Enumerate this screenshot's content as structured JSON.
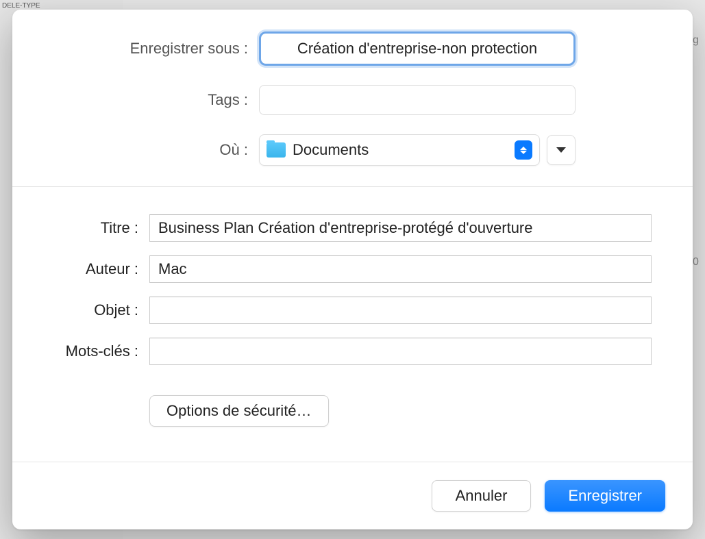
{
  "background": {
    "header": "DELE-TYPE"
  },
  "dialog": {
    "save_as_label": "Enregistrer sous :",
    "save_as_value": "Création d'entreprise-non protection",
    "tags_label": "Tags :",
    "tags_value": "",
    "where_label": "Où :",
    "where_selected": "Documents",
    "metadata": {
      "title_label": "Titre :",
      "title_value": "Business Plan Création d'entreprise-protégé d'ouverture",
      "author_label": "Auteur :",
      "author_value": "Mac",
      "subject_label": "Objet :",
      "subject_value": "",
      "keywords_label": "Mots-clés :",
      "keywords_value": ""
    },
    "security_button": "Options de sécurité…",
    "cancel_button": "Annuler",
    "save_button": "Enregistrer"
  }
}
